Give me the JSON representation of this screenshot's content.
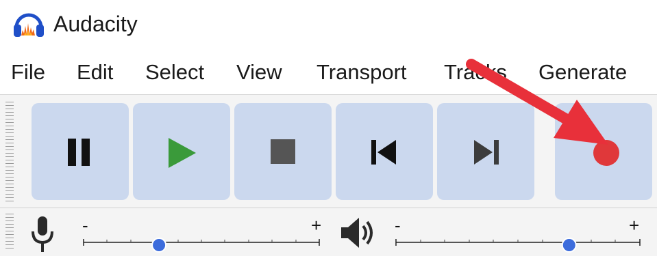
{
  "window": {
    "title": "Audacity",
    "icon": "audacity-headphones-icon"
  },
  "menu": [
    {
      "label": "File"
    },
    {
      "label": "Edit"
    },
    {
      "label": "Select"
    },
    {
      "label": "View"
    },
    {
      "label": "Transport"
    },
    {
      "label": "Tracks"
    },
    {
      "label": "Generate"
    }
  ],
  "transport": {
    "buttons": [
      {
        "name": "pause",
        "icon": "pause-icon"
      },
      {
        "name": "play",
        "icon": "play-icon"
      },
      {
        "name": "stop",
        "icon": "stop-icon"
      },
      {
        "name": "skip-to-start",
        "icon": "skip-start-icon"
      },
      {
        "name": "skip-to-end",
        "icon": "skip-end-icon"
      },
      {
        "name": "record",
        "icon": "record-icon"
      }
    ]
  },
  "recording_volume": {
    "minus_label": "-",
    "plus_label": "+",
    "level": 0.32,
    "icon": "microphone-icon"
  },
  "playback_volume": {
    "minus_label": "-",
    "plus_label": "+",
    "level": 0.71,
    "icon": "speaker-icon"
  },
  "annotation": {
    "icon": "red-arrow-pointing-to-record",
    "color": "#e8303a"
  },
  "colors": {
    "button_bg": "#cbd8ee",
    "play_green": "#3a9a3a",
    "record_red": "#e0383a",
    "slider_thumb": "#3c6cdc"
  }
}
